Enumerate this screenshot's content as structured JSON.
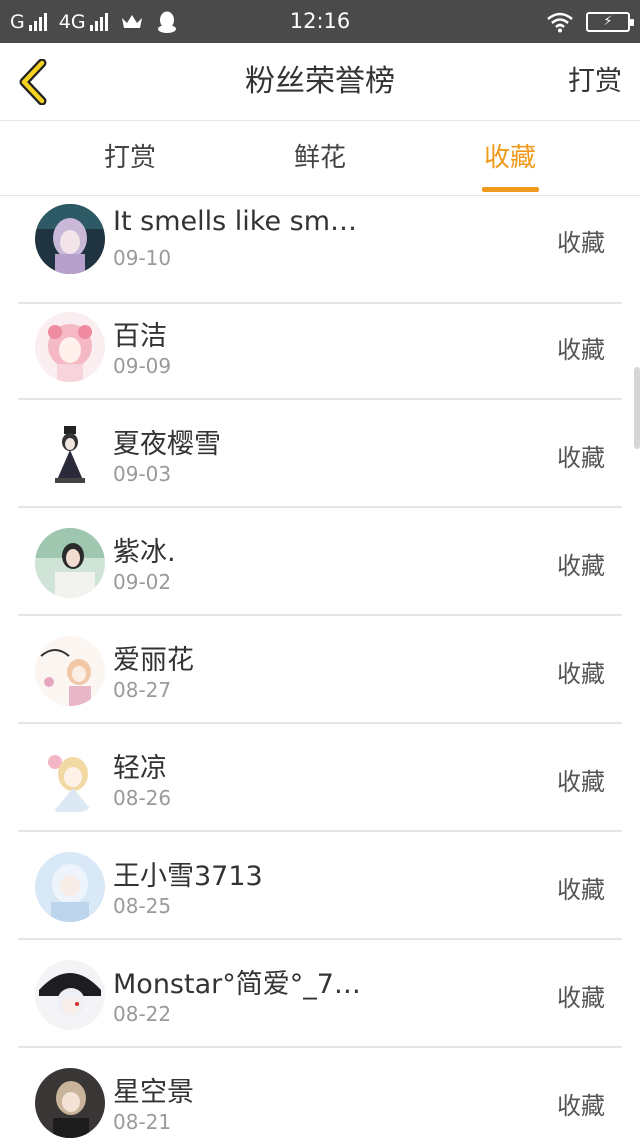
{
  "status_bar": {
    "carrier1": "G",
    "carrier2": "4G",
    "time": "12:16"
  },
  "header": {
    "title": "粉丝荣誉榜",
    "action_label": "打赏",
    "accent_color": "#ef9a1a"
  },
  "tabs": [
    {
      "label": "打赏",
      "active": false
    },
    {
      "label": "鲜花",
      "active": false
    },
    {
      "label": "收藏",
      "active": true
    }
  ],
  "list": {
    "items": [
      {
        "name": "It smells like sm…",
        "date": "09-10",
        "action": "收藏"
      },
      {
        "name": "百洁",
        "date": "09-09",
        "action": "收藏"
      },
      {
        "name": "夏夜樱雪",
        "date": "09-03",
        "action": "收藏"
      },
      {
        "name": "紫冰.",
        "date": "09-02",
        "action": "收藏"
      },
      {
        "name": "爱丽花",
        "date": "08-27",
        "action": "收藏"
      },
      {
        "name": "轻凉",
        "date": "08-26",
        "action": "收藏"
      },
      {
        "name": "王小雪3713",
        "date": "08-25",
        "action": "收藏"
      },
      {
        "name": "Monstar°简爱°_7…",
        "date": "08-22",
        "action": "收藏"
      },
      {
        "name": "星空景",
        "date": "08-21",
        "action": "收藏"
      }
    ]
  }
}
